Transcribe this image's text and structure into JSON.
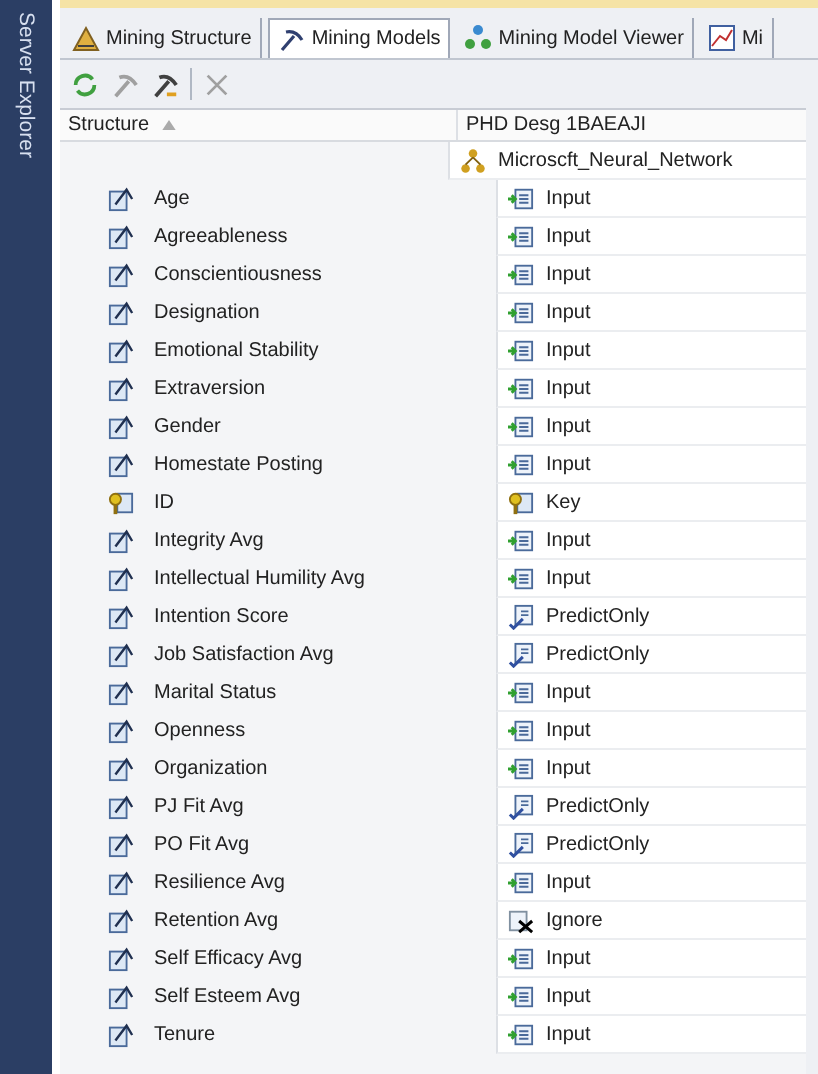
{
  "sidebar": {
    "label": "Server Explorer"
  },
  "tabs": [
    {
      "label": "Mining Structure",
      "kind": "structure",
      "selected": false
    },
    {
      "label": "Mining Models",
      "kind": "models",
      "selected": true
    },
    {
      "label": "Mining Model Viewer",
      "kind": "viewer",
      "selected": false
    },
    {
      "label": "Mi",
      "kind": "chart",
      "selected": false
    }
  ],
  "table": {
    "columns": [
      "Structure",
      "PHD Desg 1BAEAJI"
    ],
    "model": "Microscft_Neural_Network",
    "rows": [
      {
        "name": "Age",
        "kind": "column",
        "usage": {
          "label": "Input",
          "kind": "input"
        }
      },
      {
        "name": "Agreeableness",
        "kind": "column",
        "usage": {
          "label": "Input",
          "kind": "input"
        }
      },
      {
        "name": "Conscientiousness",
        "kind": "column",
        "usage": {
          "label": "Input",
          "kind": "input"
        }
      },
      {
        "name": "Designation",
        "kind": "column",
        "usage": {
          "label": "Input",
          "kind": "input"
        }
      },
      {
        "name": "Emotional Stability",
        "kind": "column",
        "usage": {
          "label": "Input",
          "kind": "input"
        }
      },
      {
        "name": "Extraversion",
        "kind": "column",
        "usage": {
          "label": "Input",
          "kind": "input"
        }
      },
      {
        "name": "Gender",
        "kind": "column",
        "usage": {
          "label": "Input",
          "kind": "input"
        }
      },
      {
        "name": "Homestate  Posting",
        "kind": "column",
        "usage": {
          "label": "Input",
          "kind": "input"
        }
      },
      {
        "name": "ID",
        "kind": "key",
        "usage": {
          "label": "Key",
          "kind": "key"
        }
      },
      {
        "name": "Integrity Avg",
        "kind": "column",
        "usage": {
          "label": "Input",
          "kind": "input"
        }
      },
      {
        "name": "Intellectual Humility Avg",
        "kind": "column",
        "usage": {
          "label": "Input",
          "kind": "input"
        }
      },
      {
        "name": "Intention Score",
        "kind": "column",
        "usage": {
          "label": "PredictOnly",
          "kind": "predict"
        }
      },
      {
        "name": "Job Satisfaction Avg",
        "kind": "column",
        "usage": {
          "label": "PredictOnly",
          "kind": "predict"
        }
      },
      {
        "name": "Marital Status",
        "kind": "column",
        "usage": {
          "label": "Input",
          "kind": "input"
        }
      },
      {
        "name": "Openness",
        "kind": "column",
        "usage": {
          "label": "Input",
          "kind": "input"
        }
      },
      {
        "name": "Organization",
        "kind": "column",
        "usage": {
          "label": "Input",
          "kind": "input"
        }
      },
      {
        "name": "PJ Fit Avg",
        "kind": "column",
        "usage": {
          "label": "PredictOnly",
          "kind": "predict"
        }
      },
      {
        "name": "PO Fit Avg",
        "kind": "column",
        "usage": {
          "label": "PredictOnly",
          "kind": "predict"
        }
      },
      {
        "name": "Resilience Avg",
        "kind": "column",
        "usage": {
          "label": "Input",
          "kind": "input"
        }
      },
      {
        "name": "Retention Avg",
        "kind": "column",
        "usage": {
          "label": "Ignore",
          "kind": "ignore"
        }
      },
      {
        "name": "Self Efficacy Avg",
        "kind": "column",
        "usage": {
          "label": "Input",
          "kind": "input"
        }
      },
      {
        "name": "Self Esteem Avg",
        "kind": "column",
        "usage": {
          "label": "Input",
          "kind": "input"
        }
      },
      {
        "name": "Tenure",
        "kind": "column",
        "usage": {
          "label": "Input",
          "kind": "input"
        }
      }
    ]
  }
}
